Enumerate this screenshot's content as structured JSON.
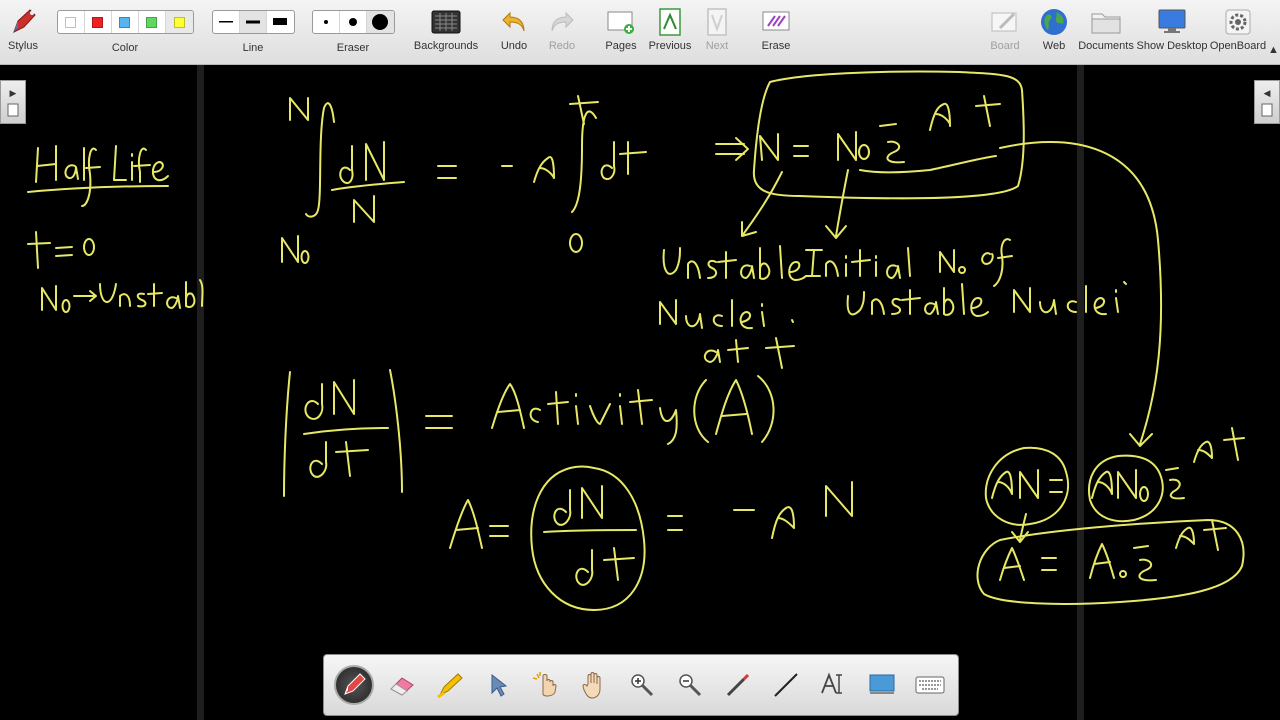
{
  "toolbar": {
    "stylus": "Stylus",
    "color": "Color",
    "line": "Line",
    "eraser": "Eraser",
    "backgrounds": "Backgrounds",
    "undo": "Undo",
    "redo": "Redo",
    "pages": "Pages",
    "previous": "Previous",
    "next": "Next",
    "erase": "Erase",
    "board": "Board",
    "web": "Web",
    "documents": "Documents",
    "show_desktop": "Show Desktop",
    "openboard": "OpenBoard",
    "colors": [
      "#ffffff",
      "#f02020",
      "#56b4f0",
      "#60d860",
      "#ffff33"
    ],
    "selected_color": "#ffff33"
  },
  "colors": {
    "ink": "#e8e867",
    "board_background": "#000000"
  },
  "board_icons": {
    "left_tab": "page-list-icon",
    "right_tab": "library-icon"
  },
  "stylus_palette": {
    "tools": [
      "pen-icon",
      "eraser-icon",
      "highlighter-icon",
      "selector-icon",
      "interactor-icon",
      "hand-icon",
      "zoom-in-icon",
      "zoom-out-icon",
      "laser-pointer-icon",
      "line-icon",
      "text-icon",
      "capture-icon",
      "keyboard-icon"
    ],
    "active_tool": "pen-icon"
  }
}
